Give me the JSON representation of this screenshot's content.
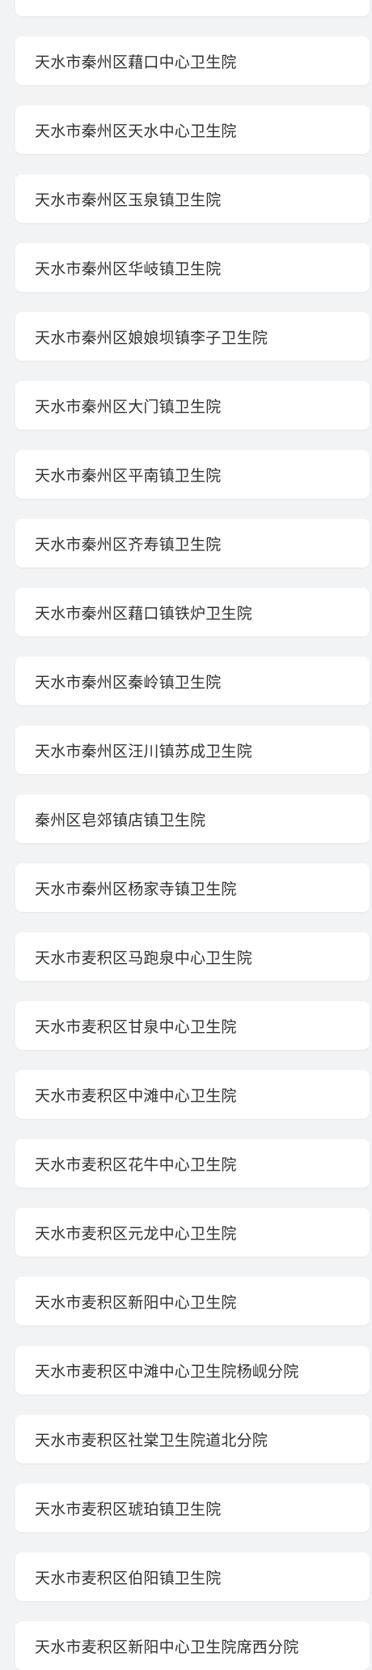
{
  "hospitals": [
    "",
    "天水市秦州区藉口中心卫生院",
    "天水市秦州区天水中心卫生院",
    "天水市秦州区玉泉镇卫生院",
    "天水市秦州区华岐镇卫生院",
    "天水市秦州区娘娘坝镇李子卫生院",
    "天水市秦州区大门镇卫生院",
    "天水市秦州区平南镇卫生院",
    "天水市秦州区齐寿镇卫生院",
    "天水市秦州区藉口镇铁炉卫生院",
    "天水市秦州区秦岭镇卫生院",
    "天水市秦州区汪川镇苏成卫生院",
    "秦州区皂郊镇店镇卫生院",
    "天水市秦州区杨家寺镇卫生院",
    "天水市麦积区马跑泉中心卫生院",
    "天水市麦积区甘泉中心卫生院",
    "天水市麦积区中滩中心卫生院",
    "天水市麦积区花牛中心卫生院",
    "天水市麦积区元龙中心卫生院",
    "天水市麦积区新阳中心卫生院",
    "天水市麦积区中滩中心卫生院杨岘分院",
    "天水市麦积区社棠卫生院道北分院",
    "天水市麦积区琥珀镇卫生院",
    "天水市麦积区伯阳镇卫生院",
    "天水市麦积区新阳中心卫生院席西分院"
  ]
}
